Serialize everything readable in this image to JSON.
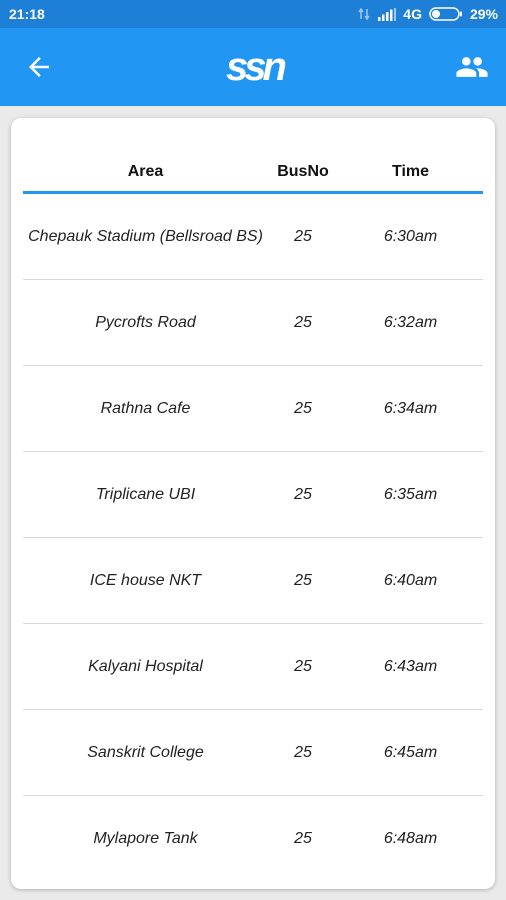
{
  "status_bar": {
    "time": "21:18",
    "network": "4G",
    "battery": "29%",
    "battery_level": 0.29,
    "icons": [
      "data-transfer-icon",
      "signal-icon",
      "battery-icon"
    ]
  },
  "app_bar": {
    "logo": "ssn",
    "back_icon": "arrow-left-icon",
    "people_icon": "people-icon",
    "color": "#2196f3"
  },
  "table": {
    "headers": {
      "area": "Area",
      "busno": "BusNo",
      "time": "Time"
    },
    "rows": [
      {
        "area": "Chepauk Stadium (Bellsroad BS)",
        "busno": "25",
        "time": "6:30am"
      },
      {
        "area": "Pycrofts Road",
        "busno": "25",
        "time": "6:32am"
      },
      {
        "area": "Rathna Cafe",
        "busno": "25",
        "time": "6:34am"
      },
      {
        "area": "Triplicane UBI",
        "busno": "25",
        "time": "6:35am"
      },
      {
        "area": "ICE house NKT",
        "busno": "25",
        "time": "6:40am"
      },
      {
        "area": "Kalyani Hospital",
        "busno": "25",
        "time": "6:43am"
      },
      {
        "area": "Sanskrit College",
        "busno": "25",
        "time": "6:45am"
      },
      {
        "area": "Mylapore Tank",
        "busno": "25",
        "time": "6:48am"
      }
    ]
  }
}
